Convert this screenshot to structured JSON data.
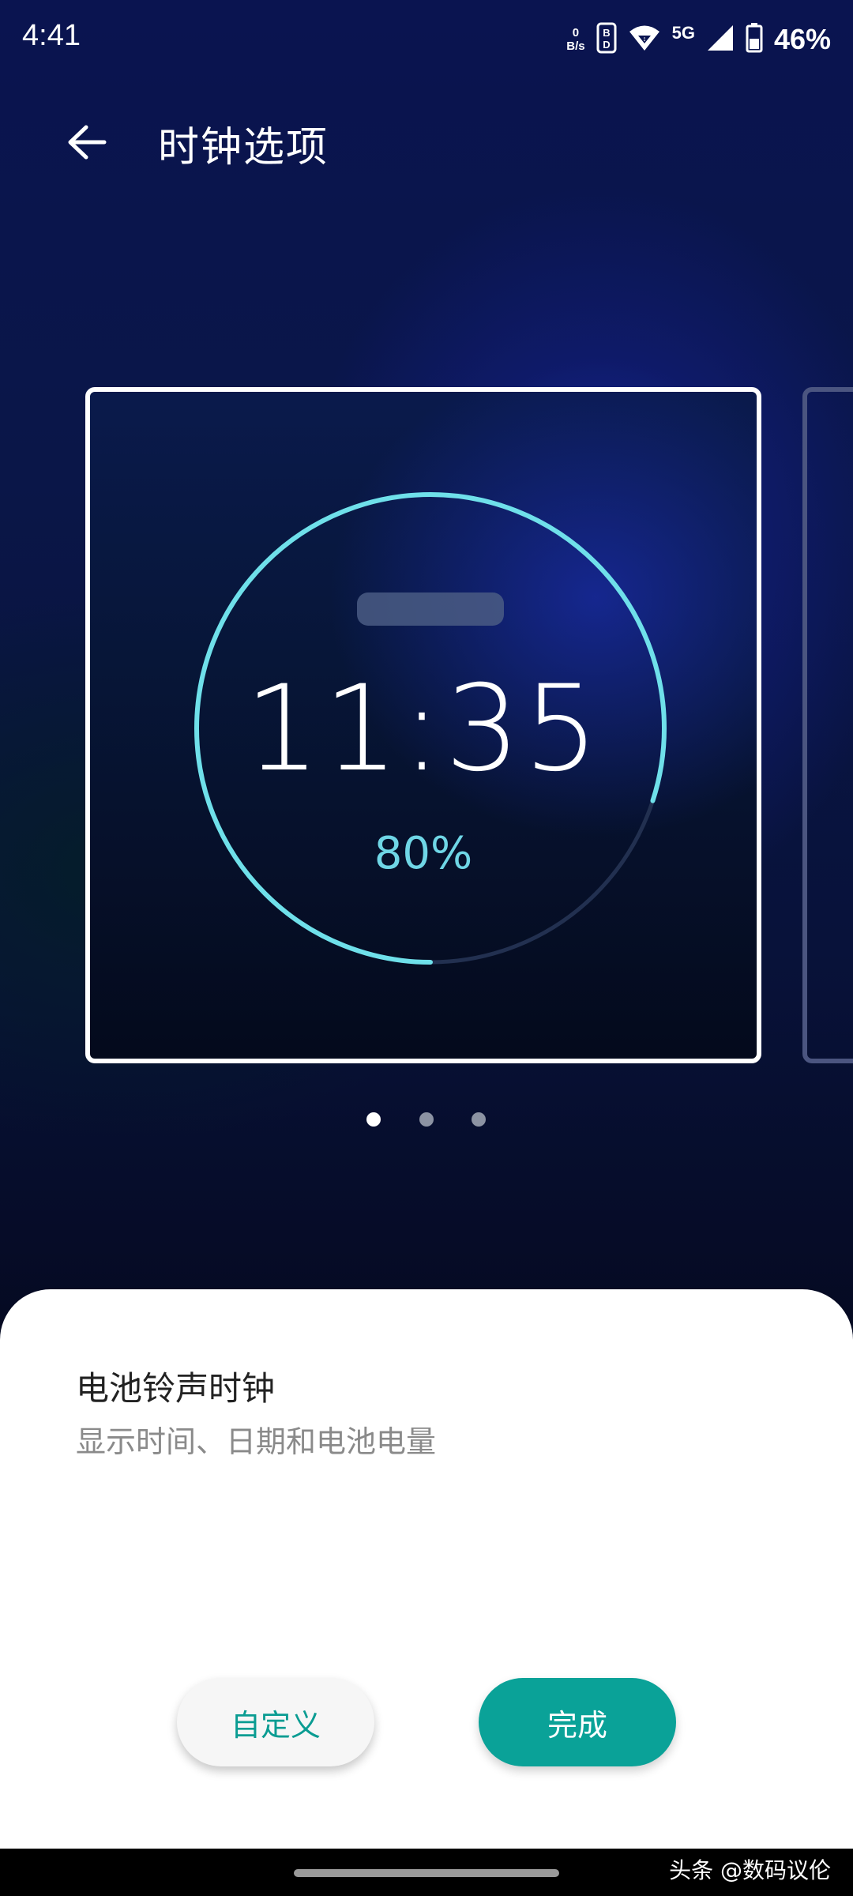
{
  "status_bar": {
    "time": "4:41",
    "net_speed_value": "0",
    "net_speed_unit": "B/s",
    "network_type": "5G",
    "battery_percent": "46%",
    "icons": [
      "data-saver-icon",
      "wifi-icon",
      "cellular-signal-icon",
      "battery-icon"
    ]
  },
  "header": {
    "title": "时钟选项",
    "back_icon": "arrow-left-icon"
  },
  "preview": {
    "clock_time": "11:35",
    "battery_level": "80%",
    "battery_fraction": 0.8,
    "accent_color": "#6fe0ea",
    "track_color": "#223050"
  },
  "pager": {
    "count": 3,
    "active_index": 0
  },
  "sheet": {
    "title": "电池铃声时钟",
    "subtitle": "显示时间、日期和电池电量",
    "customize_label": "自定义",
    "done_label": "完成",
    "accent_color": "#0aa298"
  },
  "watermark": "头条 @数码议伦"
}
